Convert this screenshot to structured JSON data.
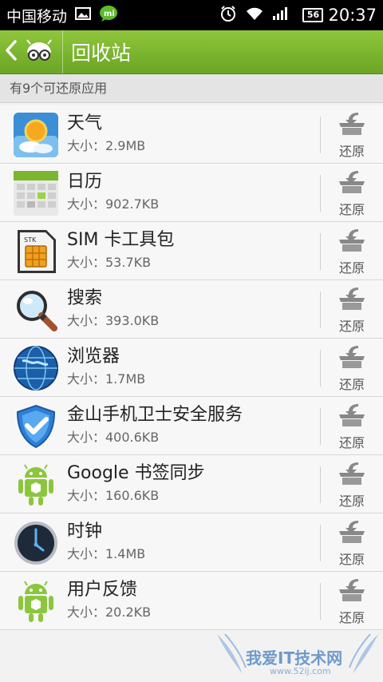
{
  "statusbar": {
    "carrier": "中国移动",
    "battery": "56",
    "time": "20:37"
  },
  "actionbar": {
    "title": "回收站"
  },
  "subheader": "有9个可还原应用",
  "restore_label": "还原",
  "apps": [
    {
      "name": "天气",
      "size": "大小：2.9MB",
      "icon": "weather-icon"
    },
    {
      "name": "日历",
      "size": "大小：902.7KB",
      "icon": "calendar-icon"
    },
    {
      "name": "SIM 卡工具包",
      "size": "大小：53.7KB",
      "icon": "sim-card-icon"
    },
    {
      "name": "搜索",
      "size": "大小：393.0KB",
      "icon": "search-icon"
    },
    {
      "name": "浏览器",
      "size": "大小：1.7MB",
      "icon": "browser-globe-icon"
    },
    {
      "name": "金山手机卫士安全服务",
      "size": "大小：400.6KB",
      "icon": "shield-icon"
    },
    {
      "name": "Google 书签同步",
      "size": "大小：160.6KB",
      "icon": "android-icon"
    },
    {
      "name": "时钟",
      "size": "大小：1.4MB",
      "icon": "clock-icon"
    },
    {
      "name": "用户反馈",
      "size": "大小：20.2KB",
      "icon": "android-icon"
    }
  ],
  "watermark": {
    "text": "我爱IT技术网",
    "sub": "www.52ij.com"
  }
}
